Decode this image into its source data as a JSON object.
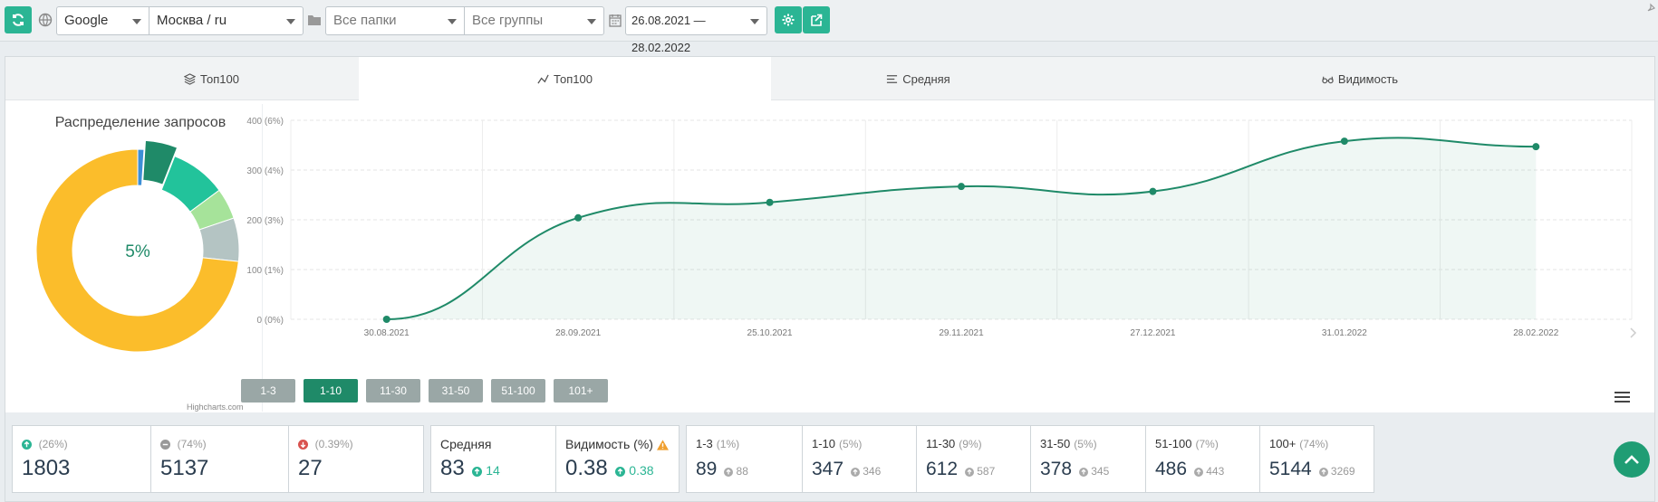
{
  "toolbar": {
    "engine": "Google",
    "region": "Москва / ru",
    "folders_placeholder": "Все папки",
    "groups_placeholder": "Все группы",
    "date_range": "26.08.2021 — 28.02.2022"
  },
  "tabs": [
    {
      "label": "Топ100",
      "icon": "layers-icon"
    },
    {
      "label": "Топ100",
      "icon": "line-chart-icon"
    },
    {
      "label": "Средняя",
      "icon": "list-icon"
    },
    {
      "label": "Видимость",
      "icon": "glasses-icon"
    }
  ],
  "donut": {
    "title": "Распределение запросов",
    "center_label": "5%",
    "credit": "Highcharts.com",
    "slices": [
      {
        "label": "1-3",
        "percent": 1,
        "color": "#3d8fd6"
      },
      {
        "label": "1-10",
        "percent": 5,
        "color": "#1f8a68"
      },
      {
        "label": "11-30",
        "percent": 9,
        "color": "#22c39b"
      },
      {
        "label": "31-50",
        "percent": 5,
        "color": "#a6e39a"
      },
      {
        "label": "51-100",
        "percent": 7,
        "color": "#b4c4c3"
      },
      {
        "label": "100+",
        "percent": 74,
        "color": "#fbbd2b"
      }
    ]
  },
  "chart_data": {
    "type": "area",
    "x": [
      "30.08.2021",
      "28.09.2021",
      "25.10.2021",
      "29.11.2021",
      "27.12.2021",
      "31.01.2022",
      "28.02.2022"
    ],
    "series": [
      {
        "values": [
          0,
          204,
          235,
          267,
          257,
          358,
          347
        ],
        "color": "#1f8a68"
      }
    ],
    "yticks": [
      "0 (0%)",
      "100 (1%)",
      "200 (3%)",
      "300 (4%)",
      "400 (6%)"
    ],
    "ylim": [
      0,
      400
    ],
    "grid": true
  },
  "range_buttons": [
    "1-3",
    "1-10",
    "11-30",
    "31-50",
    "51-100",
    "101+"
  ],
  "range_active": "1-10",
  "stats": {
    "up": {
      "pct": "(26%)",
      "value": "1803"
    },
    "same": {
      "pct": "(74%)",
      "value": "5137"
    },
    "down": {
      "pct": "(0.39%)",
      "value": "27"
    },
    "avg": {
      "label": "Средняя",
      "value": "83",
      "delta": "14"
    },
    "visibility": {
      "label": "Видимость (%)",
      "value": "0.38",
      "delta": "0.38"
    },
    "ranges": [
      {
        "label": "1-3",
        "pct": "(1%)",
        "value": "89",
        "prev": "88"
      },
      {
        "label": "1-10",
        "pct": "(5%)",
        "value": "347",
        "prev": "346"
      },
      {
        "label": "11-30",
        "pct": "(9%)",
        "value": "612",
        "prev": "587"
      },
      {
        "label": "31-50",
        "pct": "(5%)",
        "value": "378",
        "prev": "345"
      },
      {
        "label": "51-100",
        "pct": "(7%)",
        "value": "486",
        "prev": "443"
      },
      {
        "label": "100+",
        "pct": "(74%)",
        "value": "5144",
        "prev": "3269"
      }
    ]
  }
}
